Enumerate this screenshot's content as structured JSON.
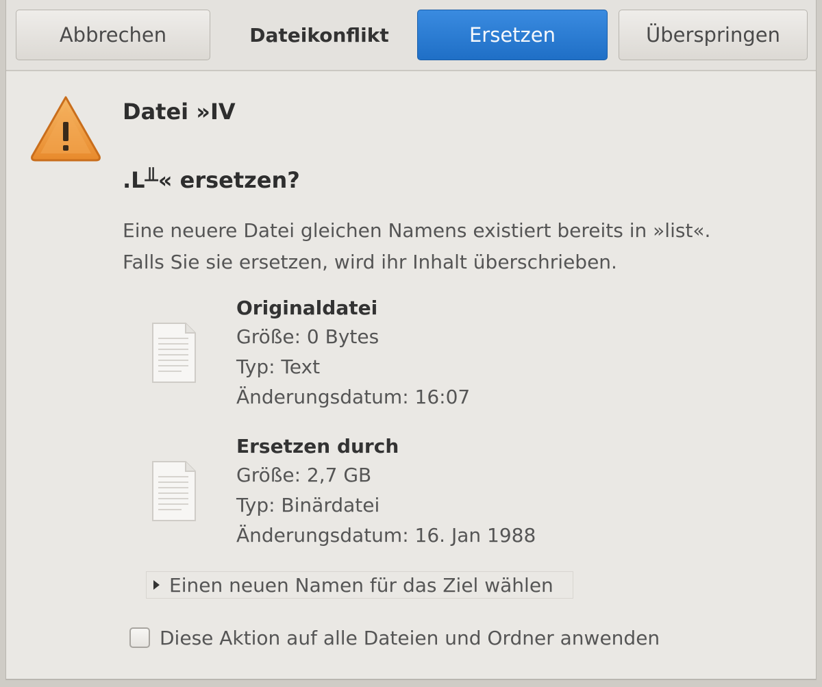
{
  "header": {
    "cancel_label": "Abbrechen",
    "title": "Dateikonflikt",
    "replace_label": "Ersetzen",
    "skip_label": "Überspringen"
  },
  "heading": "Datei »IV\n\n.L╨« ersetzen?",
  "description": {
    "line1": "Eine neuere Datei gleichen Namens existiert bereits in »list«.",
    "line2": "Falls Sie sie ersetzen, wird ihr Inhalt überschrieben."
  },
  "original": {
    "title": "Originaldatei",
    "size": "Größe: 0 Bytes",
    "type": "Typ: Text",
    "modified": "Änderungsdatum: 16:07"
  },
  "replacement": {
    "title": "Ersetzen durch",
    "size": "Größe: 2,7 GB",
    "type": "Typ: Binärdatei",
    "modified": "Änderungsdatum: 16. Jan 1988"
  },
  "rename_expander_label": "Einen neuen Namen für das Ziel wählen",
  "apply_all_label": "Diese Aktion auf alle Dateien und Ordner anwenden",
  "apply_all_checked": false,
  "colors": {
    "accent": "#2a7bd6",
    "warning": "#f09a3e"
  },
  "icons": {
    "warning": "warning-triangle-icon",
    "file": "text-file-icon",
    "expander": "triangle-right-icon"
  }
}
